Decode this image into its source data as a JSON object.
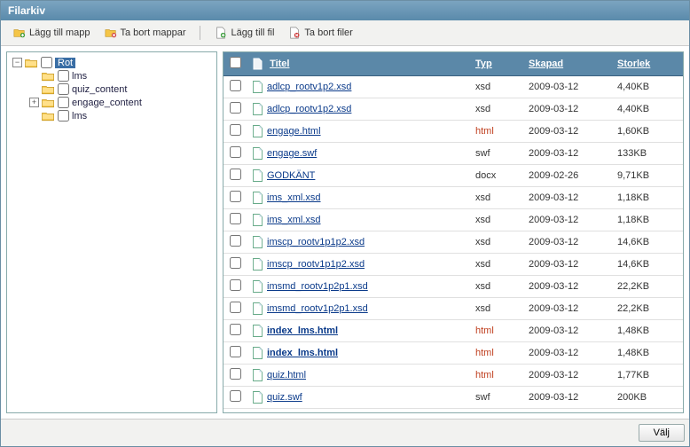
{
  "title": "Filarkiv",
  "toolbar": {
    "addFolder": "Lägg till mapp",
    "removeFolders": "Ta bort mappar",
    "addFile": "Lägg till fil",
    "removeFiles": "Ta bort filer"
  },
  "tree": {
    "root": {
      "label": "Rot",
      "selected": true,
      "expanded": true
    },
    "children": [
      {
        "label": "lms",
        "hasChildren": false
      },
      {
        "label": "quiz_content",
        "hasChildren": false
      },
      {
        "label": "engage_content",
        "hasChildren": true
      },
      {
        "label": "lms",
        "hasChildren": false
      }
    ]
  },
  "columns": {
    "title": "Titel",
    "type": "Typ",
    "created": "Skapad",
    "size": "Storlek"
  },
  "files": [
    {
      "name": "adlcp_rootv1p2.xsd",
      "type": "xsd",
      "date": "2009-03-12",
      "size": "4,40KB",
      "bold": false
    },
    {
      "name": "adlcp_rootv1p2.xsd",
      "type": "xsd",
      "date": "2009-03-12",
      "size": "4,40KB",
      "bold": false
    },
    {
      "name": "engage.html",
      "type": "html",
      "date": "2009-03-12",
      "size": "1,60KB",
      "bold": false
    },
    {
      "name": "engage.swf",
      "type": "swf",
      "date": "2009-03-12",
      "size": "133KB",
      "bold": false
    },
    {
      "name": "GODKÄNT",
      "type": "docx",
      "date": "2009-02-26",
      "size": "9,71KB",
      "bold": false
    },
    {
      "name": "ims_xml.xsd",
      "type": "xsd",
      "date": "2009-03-12",
      "size": "1,18KB",
      "bold": false
    },
    {
      "name": "ims_xml.xsd",
      "type": "xsd",
      "date": "2009-03-12",
      "size": "1,18KB",
      "bold": false
    },
    {
      "name": "imscp_rootv1p1p2.xsd",
      "type": "xsd",
      "date": "2009-03-12",
      "size": "14,6KB",
      "bold": false
    },
    {
      "name": "imscp_rootv1p1p2.xsd",
      "type": "xsd",
      "date": "2009-03-12",
      "size": "14,6KB",
      "bold": false
    },
    {
      "name": "imsmd_rootv1p2p1.xsd",
      "type": "xsd",
      "date": "2009-03-12",
      "size": "22,2KB",
      "bold": false
    },
    {
      "name": "imsmd_rootv1p2p1.xsd",
      "type": "xsd",
      "date": "2009-03-12",
      "size": "22,2KB",
      "bold": false
    },
    {
      "name": "index_lms.html",
      "type": "html",
      "date": "2009-03-12",
      "size": "1,48KB",
      "bold": true
    },
    {
      "name": "index_lms.html",
      "type": "html",
      "date": "2009-03-12",
      "size": "1,48KB",
      "bold": true
    },
    {
      "name": "quiz.html",
      "type": "html",
      "date": "2009-03-12",
      "size": "1,77KB",
      "bold": false
    },
    {
      "name": "quiz.swf",
      "type": "swf",
      "date": "2009-03-12",
      "size": "200KB",
      "bold": false
    }
  ],
  "footer": {
    "select": "Välj"
  }
}
